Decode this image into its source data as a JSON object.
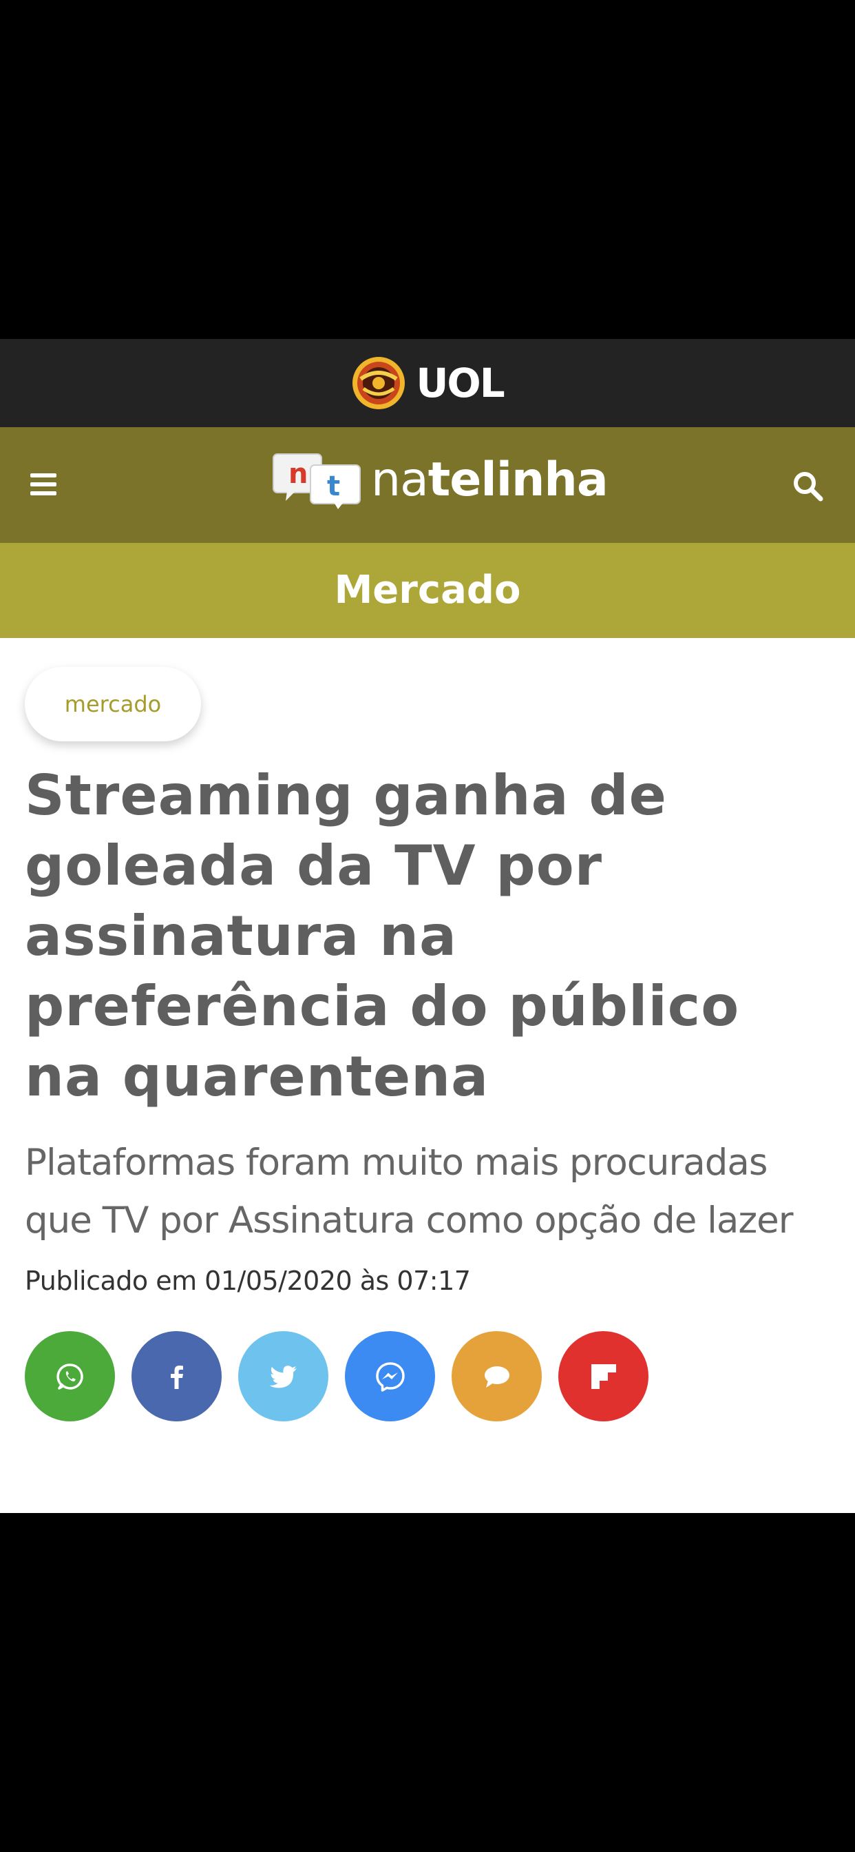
{
  "uol_bar": {
    "logo_text": "UOL",
    "background": "#232323"
  },
  "nav": {
    "brand_light": "na",
    "brand_bold": "telinha",
    "brand_icon_letters": [
      "n",
      "t"
    ],
    "menu_icon": "hamburger-menu-icon",
    "search_icon": "search-icon",
    "background": "#7a7329"
  },
  "section": {
    "title": "Mercado",
    "background": "#ada73a"
  },
  "article": {
    "tag": "mercado",
    "headline": "Streaming ganha de goleada da TV por assinatura na preferência do público na quarentena",
    "subheadline": "Plataformas foram muito mais procuradas que TV por Assinatura como opção de lazer",
    "published": "Publicado em 01/05/2020 às 07:17"
  },
  "share_buttons": [
    {
      "name": "whatsapp",
      "icon": "whatsapp-icon",
      "color": "#4caa3b"
    },
    {
      "name": "facebook",
      "icon": "facebook-icon",
      "color": "#4a68ad"
    },
    {
      "name": "twitter",
      "icon": "twitter-icon",
      "color": "#6ec3ee"
    },
    {
      "name": "messenger",
      "icon": "messenger-icon",
      "color": "#3b8bf2"
    },
    {
      "name": "comments",
      "icon": "comment-icon",
      "color": "#e6a23a"
    },
    {
      "name": "flipboard",
      "icon": "flipboard-icon",
      "color": "#e0312f"
    }
  ]
}
